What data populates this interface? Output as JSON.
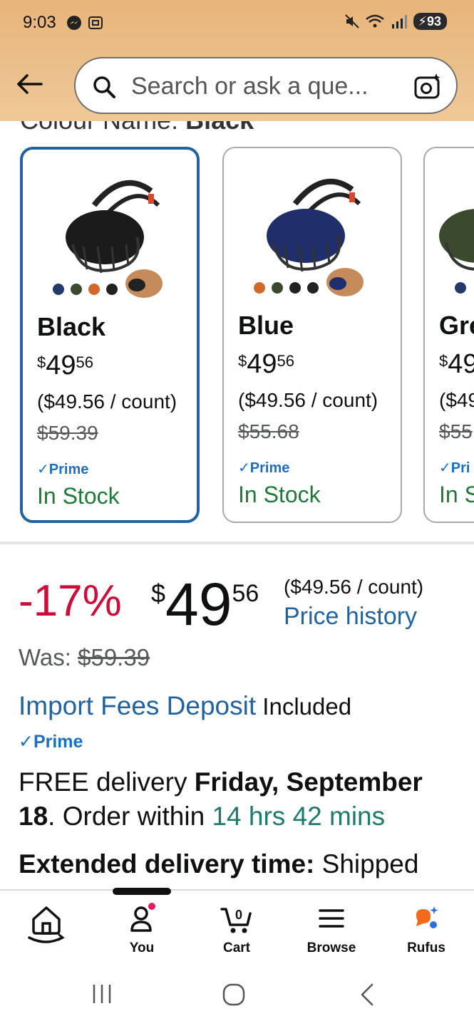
{
  "status_bar": {
    "time": "9:03",
    "battery": "93"
  },
  "header": {
    "search_placeholder": "Search or ask a que..."
  },
  "colour_heading": {
    "label": "Colour Name: ",
    "value": "Black"
  },
  "variants": [
    {
      "name": "Black",
      "price_symbol": "$",
      "price_whole": "49",
      "price_fraction": "56",
      "unit_price": "($49.56 / count)",
      "was_price": "$59.39",
      "prime": "Prime",
      "stock": "In Stock"
    },
    {
      "name": "Blue",
      "price_symbol": "$",
      "price_whole": "49",
      "price_fraction": "56",
      "unit_price": "($49.56 / count)",
      "was_price": "$55.68",
      "prime": "Prime",
      "stock": "In Stock"
    },
    {
      "name": "Gre",
      "price_symbol": "$",
      "price_whole": "49",
      "price_fraction": "",
      "unit_price": "($49",
      "was_price": "$55",
      "prime": "Pri",
      "stock": "In S"
    }
  ],
  "price_block": {
    "discount": "-17%",
    "symbol": "$",
    "whole": "49",
    "fraction": "56",
    "per_count": "($49.56 / count)",
    "price_history": "Price history",
    "was_label": "Was: ",
    "was_value": "$59.39",
    "import_link": "Import Fees Deposit",
    "import_status": " Included",
    "prime": "Prime",
    "delivery_free": "FREE delivery ",
    "delivery_date": "Friday, September 18",
    "delivery_order": ". Order within ",
    "delivery_countdown": "14 hrs 42 mins",
    "extended_label": "Extended delivery time:",
    "extended_value": " Shipped"
  },
  "bottom_nav": {
    "you": "You",
    "cart": "Cart",
    "cart_count": "0",
    "browse": "Browse",
    "rufus": "Rufus"
  },
  "colors": {
    "header_bg": "#ebbf8b",
    "selected_border": "#2162a1",
    "discount": "#cc0c39",
    "link": "#2162a1",
    "stock_green": "#1f7a3a",
    "prime_blue": "#1d6fbf"
  }
}
